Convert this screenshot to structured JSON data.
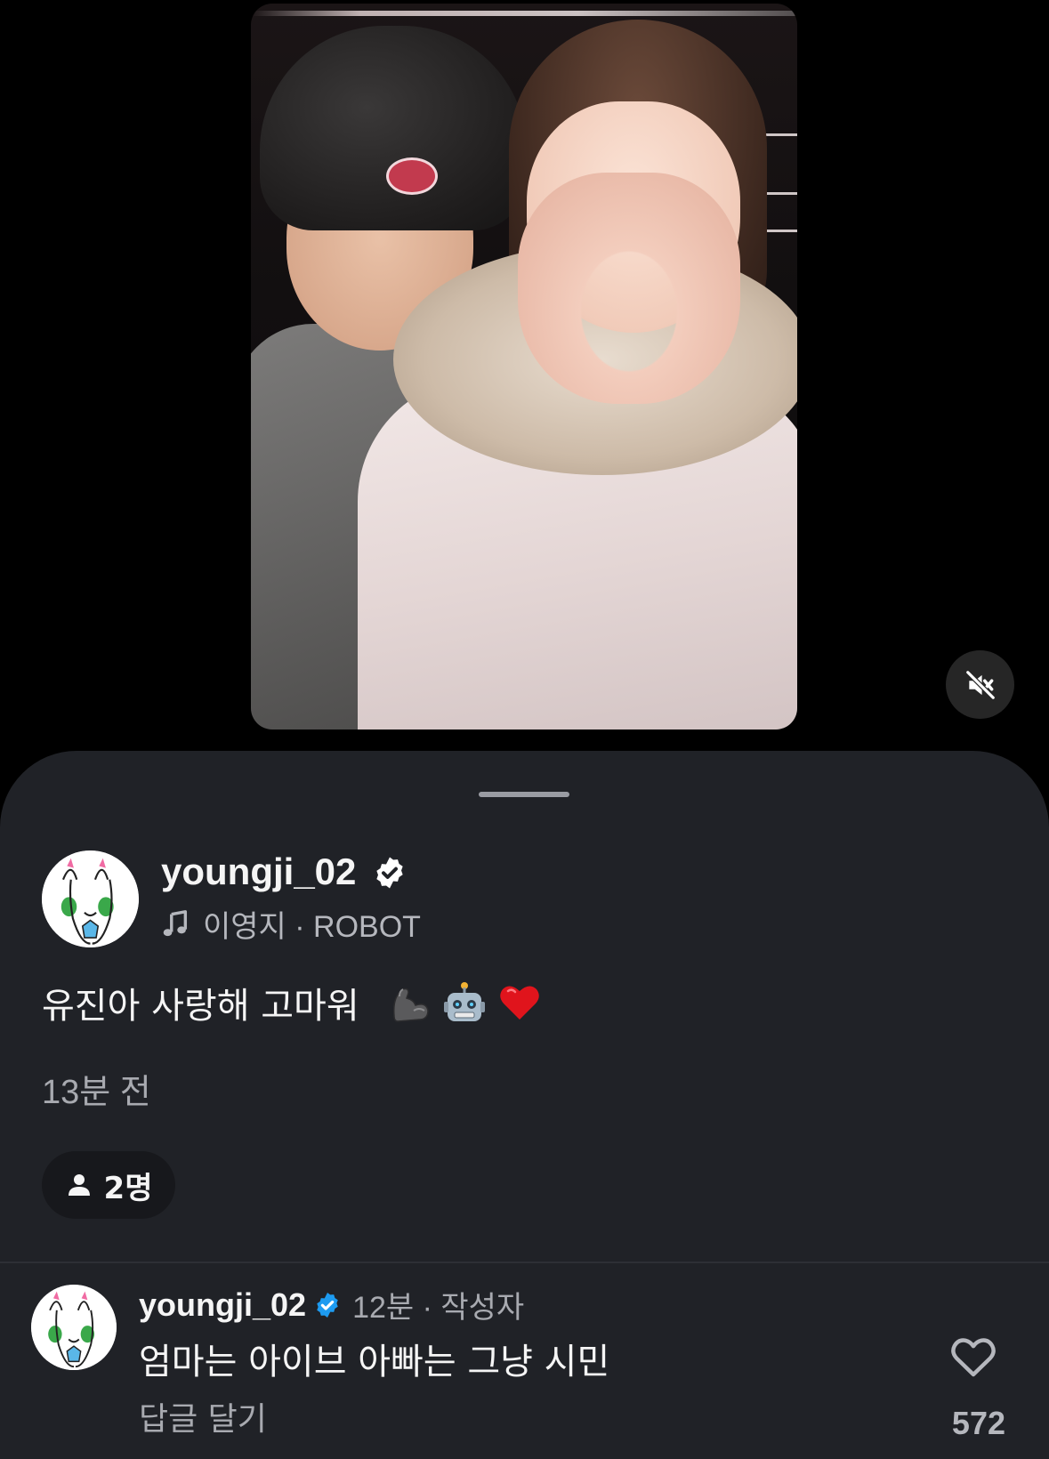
{
  "story": {
    "image_alt": "",
    "mute_icon": "speaker-muted-icon"
  },
  "post": {
    "username": "youngji_02",
    "verified_icon": "verified-badge-icon",
    "music_icon": "music-note-icon",
    "music_text": "이영지 · ROBOT",
    "caption_text": "유진아 사랑해 고마워",
    "caption_emojis": [
      "flexed-biceps-emoji",
      "robot-emoji",
      "red-heart-emoji"
    ],
    "timestamp": "13분 전",
    "viewers_icon": "person-icon",
    "viewers_count": "2명"
  },
  "comment": {
    "username": "youngji_02",
    "meta": "12분 · 작성자",
    "text": "엄마는 아이브 아빠는 그냥 시민",
    "reply_label": "답글 달기",
    "like_icon": "heart-outline-icon",
    "like_count": "572"
  },
  "colors": {
    "sheet_bg": "#202227",
    "verified_white": "#ffffff",
    "verified_blue": "#1d9bf0",
    "muted_text": "#a8aab0"
  }
}
